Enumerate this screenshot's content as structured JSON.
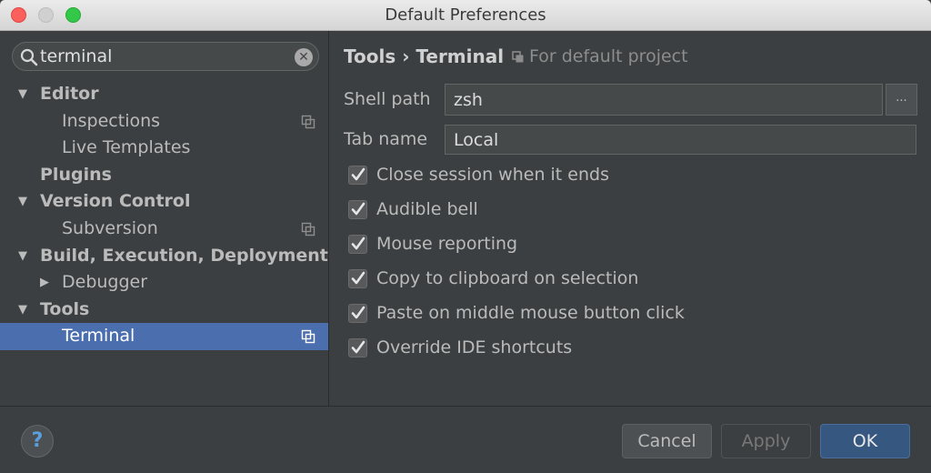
{
  "window": {
    "title": "Default Preferences"
  },
  "search": {
    "value": "terminal",
    "clear_glyph": "✕"
  },
  "tree": {
    "items": [
      {
        "label": "Editor",
        "expanded": true,
        "bold": true,
        "level": 0
      },
      {
        "label": "Inspections",
        "level": 1,
        "project_icon": true
      },
      {
        "label": "Live Templates",
        "level": 1
      },
      {
        "label": "Plugins",
        "bold": true,
        "level": 0
      },
      {
        "label": "Version Control",
        "expanded": true,
        "bold": true,
        "level": 0
      },
      {
        "label": "Subversion",
        "level": 1,
        "project_icon": true
      },
      {
        "label": "Build, Execution, Deployment",
        "expanded": true,
        "bold": true,
        "level": 0
      },
      {
        "label": "Debugger",
        "expanded": false,
        "level": 1
      },
      {
        "label": "Tools",
        "expanded": true,
        "bold": true,
        "level": 0
      },
      {
        "label": "Terminal",
        "level": 1,
        "project_icon": true,
        "selected": true
      }
    ],
    "arrow_down": "▼",
    "arrow_right": "▶"
  },
  "content": {
    "breadcrumb": "Tools › Terminal",
    "scope_label": "For default project",
    "shell_path_label": "Shell path",
    "shell_path_value": "zsh",
    "browse_label": "...",
    "tab_name_label": "Tab name",
    "tab_name_value": "Local",
    "checkboxes": [
      {
        "label": "Close session when it ends",
        "checked": true
      },
      {
        "label": "Audible bell",
        "checked": true
      },
      {
        "label": "Mouse reporting",
        "checked": true
      },
      {
        "label": "Copy to clipboard on selection",
        "checked": true
      },
      {
        "label": "Paste on middle mouse button click",
        "checked": true
      },
      {
        "label": "Override IDE shortcuts",
        "checked": true
      }
    ]
  },
  "footer": {
    "help_label": "?",
    "cancel_label": "Cancel",
    "apply_label": "Apply",
    "ok_label": "OK"
  },
  "colors": {
    "background": "#3c3f41",
    "selection": "#4b6eaf",
    "ok_button": "#365880",
    "help_accent": "#5a9fdc"
  },
  "icons": {
    "search": "search-icon",
    "clear": "clear-icon",
    "project_scope": "copy-icon",
    "check": "checkmark-icon",
    "help": "help-icon"
  }
}
